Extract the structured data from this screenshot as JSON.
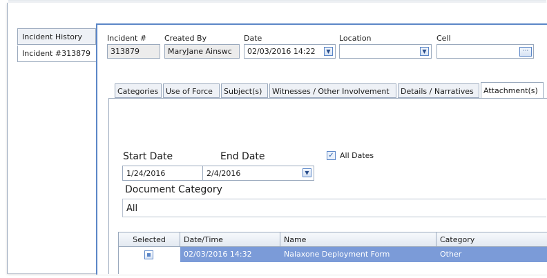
{
  "sidebar": {
    "tabs": [
      {
        "label": "Incident History"
      },
      {
        "label": "Incident #313879"
      }
    ]
  },
  "header": {
    "incident_no": {
      "label": "Incident #",
      "value": "313879"
    },
    "created_by": {
      "label": "Created By",
      "value": "MaryJane  Ainswc"
    },
    "date": {
      "label": "Date",
      "value": "02/03/2016 14:22"
    },
    "location": {
      "label": "Location",
      "value": ""
    },
    "cell": {
      "label": "Cell",
      "value": ""
    }
  },
  "tabs": [
    {
      "label": "Categories"
    },
    {
      "label": "Use of Force"
    },
    {
      "label": "Subject(s)"
    },
    {
      "label": "Witnesses / Other Involvement"
    },
    {
      "label": "Details / Narratives"
    },
    {
      "label": "Attachment(s)"
    }
  ],
  "attachments": {
    "start_date_label": "Start Date",
    "start_date_value": "1/24/2016",
    "end_date_label": "End Date",
    "end_date_value": "2/4/2016",
    "all_dates_label": "All Dates",
    "all_dates_checked": true,
    "doc_category_label": "Document Category",
    "doc_category_value": "All",
    "grid": {
      "columns": [
        "Selected",
        "Date/Time",
        "Name",
        "Category"
      ],
      "rows": [
        {
          "selected": true,
          "datetime": "02/03/2016 14:32",
          "name": "Nalaxone Deployment Form",
          "category": "Other"
        }
      ]
    }
  },
  "colors": {
    "accent": "#5b86c7",
    "selected_row": "#7b9bd8",
    "tab_inactive": "#eef1f6"
  }
}
